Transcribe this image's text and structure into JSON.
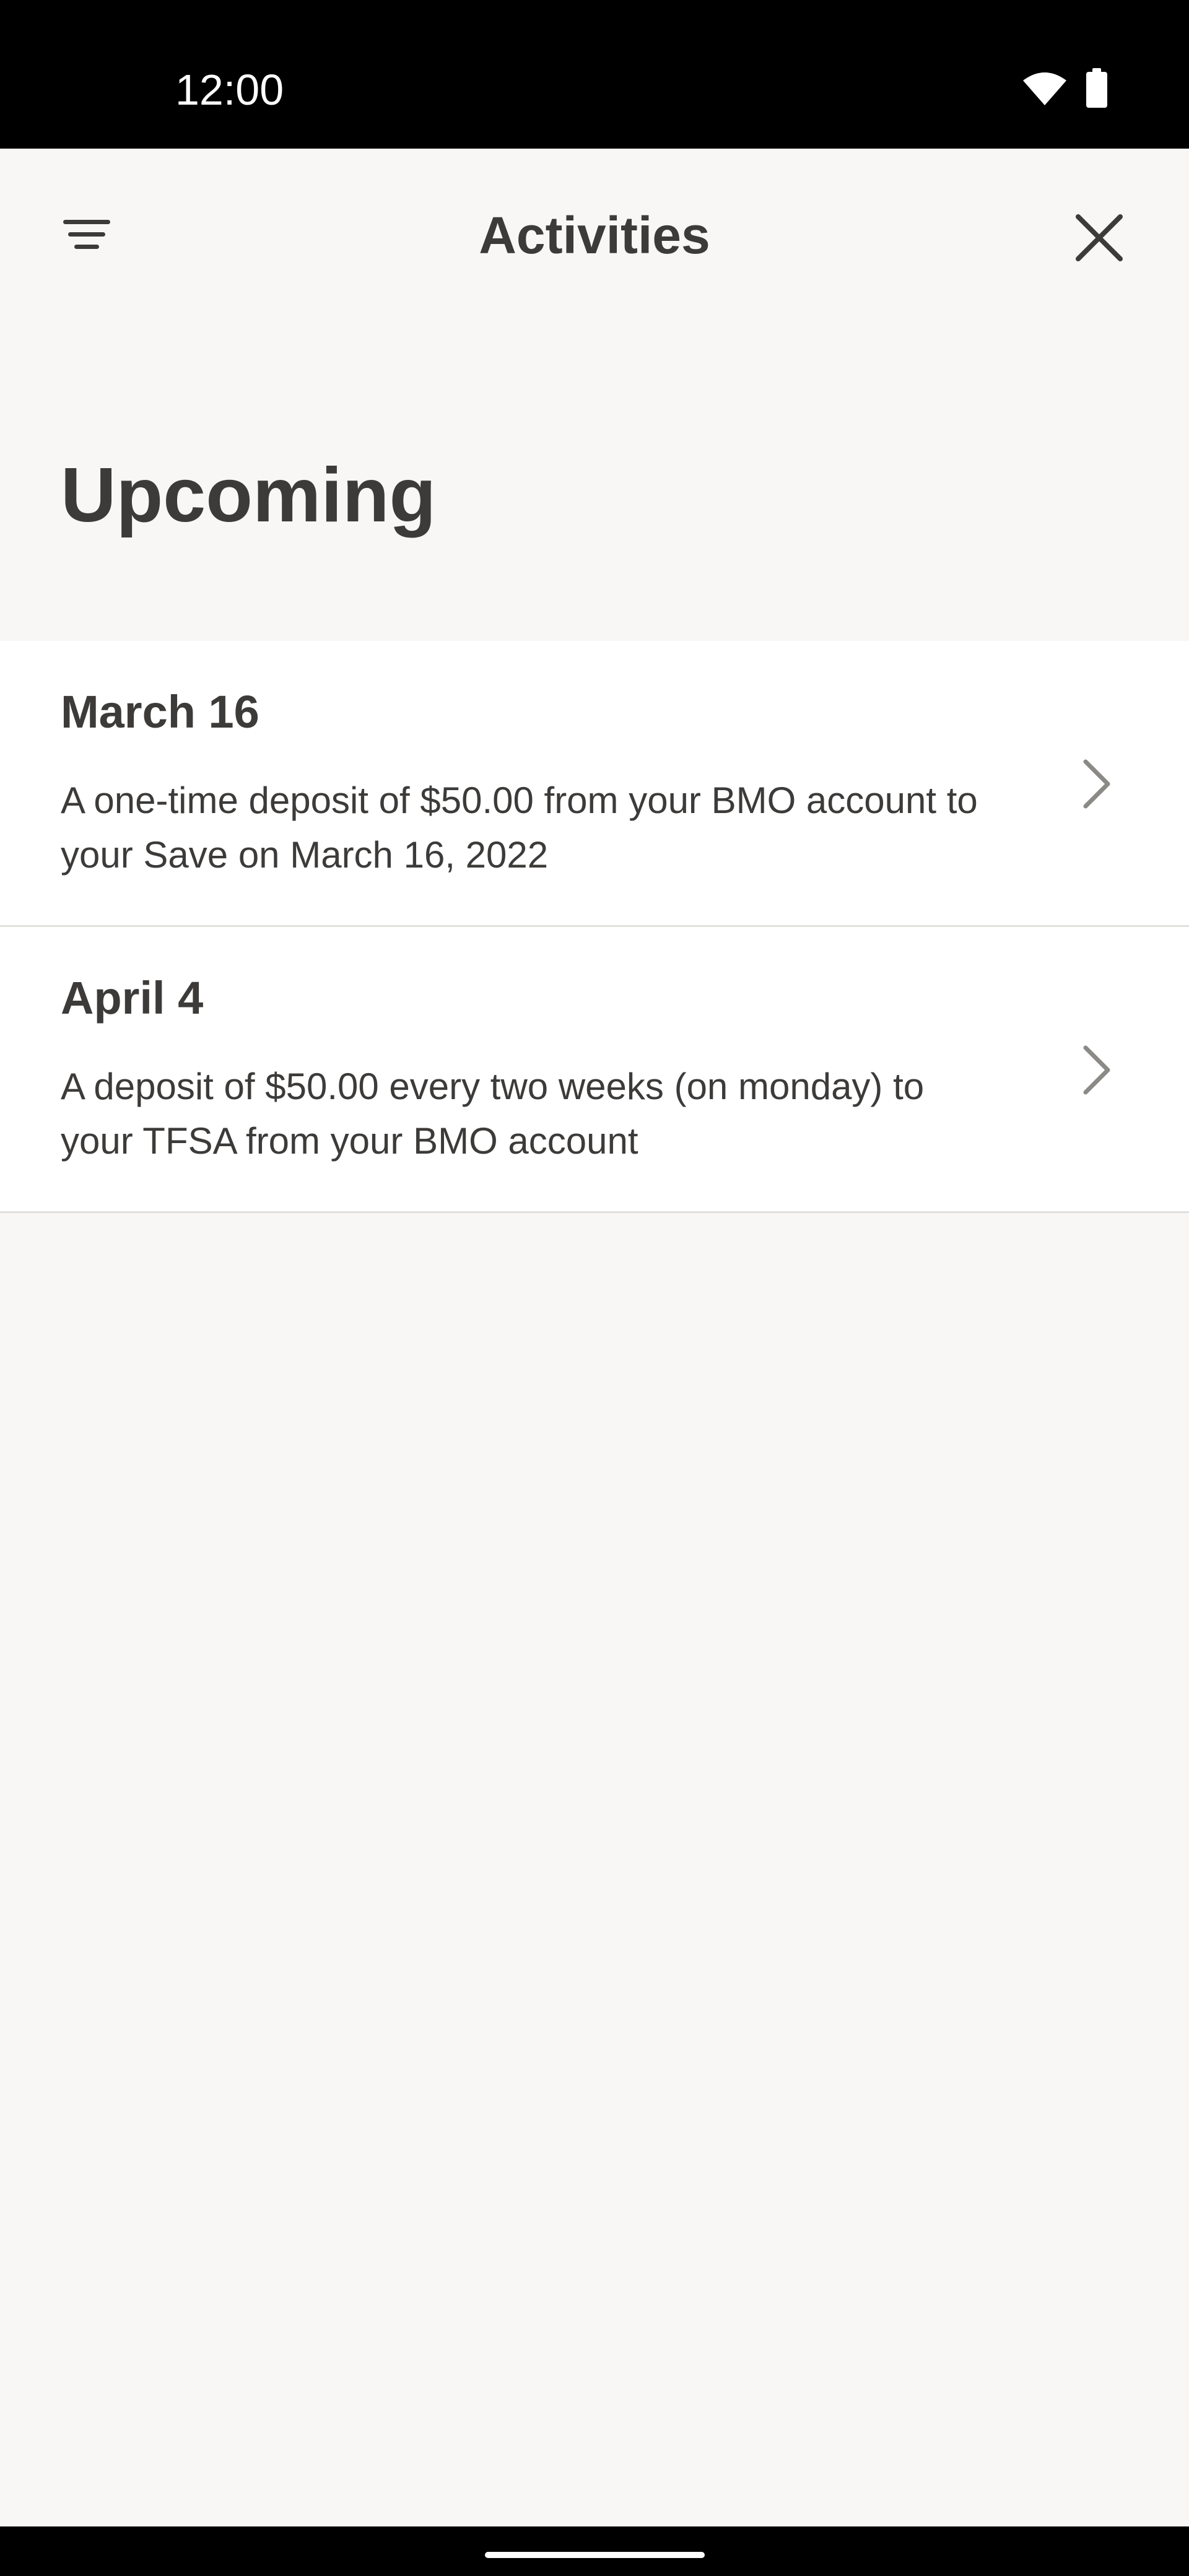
{
  "status_bar": {
    "time": "12:00",
    "icons": [
      "wifi-icon",
      "battery-icon"
    ]
  },
  "app_bar": {
    "title": "Activities",
    "left_icon": "filter-menu-icon",
    "right_icon": "close-icon"
  },
  "section": {
    "heading": "Upcoming"
  },
  "activities": [
    {
      "date": "March 16",
      "description": "A one-time deposit of $50.00 from your BMO account to your Save on March 16, 2022"
    },
    {
      "date": "April 4",
      "description": "A deposit of $50.00 every two weeks (on monday) to your TFSA from your BMO account"
    }
  ],
  "colors": {
    "background": "#f8f7f5",
    "card": "#ffffff",
    "text": "#3d3b39",
    "divider": "#e2e0dd",
    "chevron": "#8c8a87"
  }
}
